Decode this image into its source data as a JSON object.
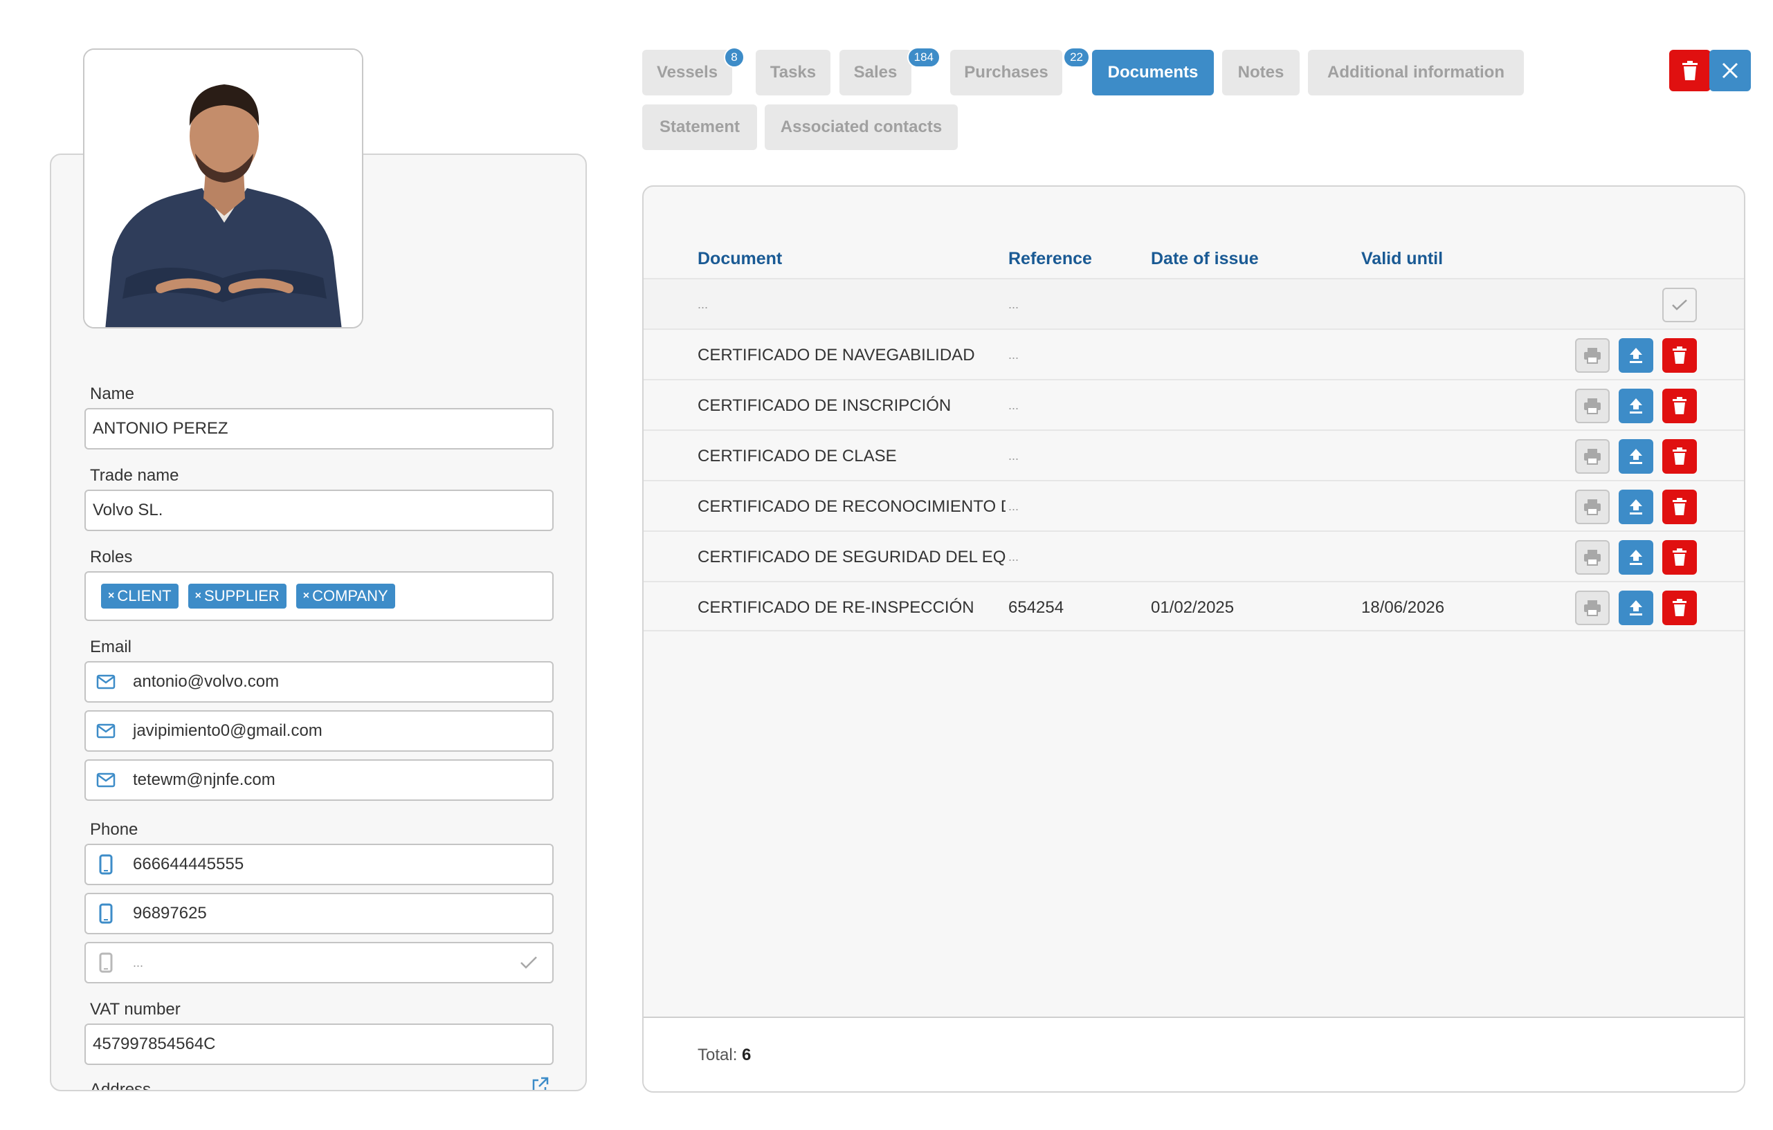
{
  "contact": {
    "name_label": "Name",
    "name_value": "ANTONIO PEREZ",
    "trade_label": "Trade name",
    "trade_value": "Volvo SL.",
    "roles_label": "Roles",
    "roles": [
      "CLIENT",
      "SUPPLIER",
      "COMPANY"
    ],
    "email_label": "Email",
    "emails": [
      "antonio@volvo.com",
      "javipimiento0@gmail.com",
      "tetewm@njnfe.com"
    ],
    "phone_label": "Phone",
    "phones": [
      "666644445555",
      "96897625"
    ],
    "phone_placeholder": "...",
    "vat_label": "VAT number",
    "vat_value": "457997854564C",
    "address_label": "Address"
  },
  "tabs": [
    {
      "label": "Vessels",
      "badge": "8"
    },
    {
      "label": "Tasks"
    },
    {
      "label": "Sales",
      "badge": "184"
    },
    {
      "label": "Purchases",
      "badge": "22"
    },
    {
      "label": "Documents",
      "active": true
    },
    {
      "label": "Notes"
    },
    {
      "label": "Additional information"
    },
    {
      "label": "Statement"
    },
    {
      "label": "Associated contacts"
    }
  ],
  "documents": {
    "headers": {
      "document": "Document",
      "reference": "Reference",
      "date_of_issue": "Date of issue",
      "valid_until": "Valid until"
    },
    "new_row": {
      "document": "...",
      "reference": "..."
    },
    "rows": [
      {
        "document": "CERTIFICADO DE NAVEGABILIDAD",
        "reference": "...",
        "date": "",
        "valid": ""
      },
      {
        "document": "CERTIFICADO DE INSCRIPCIÓN",
        "reference": "...",
        "date": "",
        "valid": ""
      },
      {
        "document": "CERTIFICADO DE CLASE",
        "reference": "...",
        "date": "",
        "valid": ""
      },
      {
        "document": "CERTIFICADO DE RECONOCIMIENTO DE",
        "reference": "...",
        "date": "",
        "valid": ""
      },
      {
        "document": "CERTIFICADO DE SEGURIDAD DEL EQUI",
        "reference": "...",
        "date": "",
        "valid": ""
      },
      {
        "document": "CERTIFICADO DE RE-INSPECCIÓN",
        "reference": "654254",
        "date": "01/02/2025",
        "valid": "18/06/2026"
      }
    ],
    "total_label": "Total:",
    "total_value": "6"
  },
  "colors": {
    "accent": "#3d8cc8",
    "danger": "#e01010",
    "header": "#1a5a94",
    "panel": "#f7f7f7"
  },
  "icons": [
    "email-icon",
    "mobile-phone-icon",
    "check-icon",
    "external-link-icon",
    "print-icon",
    "upload-icon",
    "trash-icon",
    "close-icon"
  ]
}
